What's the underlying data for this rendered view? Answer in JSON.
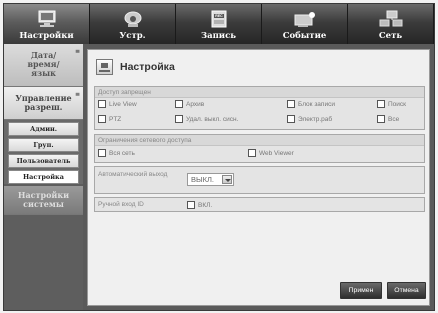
{
  "tabs": [
    {
      "label": "Настройки",
      "icon": "settings-monitor-icon",
      "active": true
    },
    {
      "label": "Устр.",
      "icon": "camera-icon",
      "active": false
    },
    {
      "label": "Запись",
      "icon": "record-icon",
      "active": false
    },
    {
      "label": "Событие",
      "icon": "event-icon",
      "active": false
    },
    {
      "label": "Сеть",
      "icon": "network-icon",
      "active": false
    }
  ],
  "sidebar": {
    "section1": "Дата/ время/ язык",
    "section2": "Управление разреш.",
    "subitems": [
      "Админ.",
      "Груп.",
      "Пользователь",
      "Настройка"
    ],
    "selected": "Настройка",
    "section3": "Настройки системы"
  },
  "main": {
    "title": "Настройка",
    "access_denied": {
      "header": "Доступ запрещен",
      "options": [
        "Live View",
        "Архив",
        "Блок записи",
        "Поиск",
        "PTZ",
        "Удал. выкл. сиcн.",
        "Электр.раб",
        "Все"
      ]
    },
    "network_limit": {
      "header": "Ограничения сетевого доступа",
      "options": [
        "Вся сеть",
        "Web Viewer"
      ]
    },
    "auto_logout": {
      "label": "Автоматический выход",
      "value": "ВЫКЛ."
    },
    "manual_login": {
      "label": "Ручной вход ID",
      "checkbox_label": "ВКЛ."
    },
    "buttons": {
      "apply": "Примен",
      "cancel": "Отмена"
    }
  }
}
